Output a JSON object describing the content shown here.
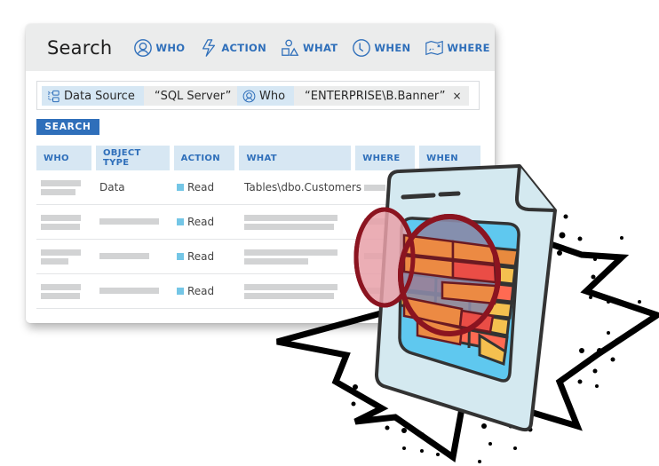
{
  "header": {
    "title": "Search",
    "nav": [
      {
        "label": "WHO",
        "icon": "user-circle-icon"
      },
      {
        "label": "ACTION",
        "icon": "lightning-icon"
      },
      {
        "label": "WHAT",
        "icon": "shapes-icon"
      },
      {
        "label": "WHEN",
        "icon": "clock-icon"
      },
      {
        "label": "WHERE",
        "icon": "map-icon"
      }
    ]
  },
  "filters": [
    {
      "key": "Data Source",
      "value": "“SQL Server”",
      "remove": "×",
      "icon": "hierarchy-icon"
    },
    {
      "key": "Who",
      "value": "“ENTERPRISE\\B.Banner”",
      "remove": "×",
      "icon": "user-circle-icon"
    }
  ],
  "search_button": "SEARCH",
  "table": {
    "columns": [
      "WHO",
      "OBJECT TYPE",
      "ACTION",
      "WHAT",
      "WHERE",
      "WHEN"
    ],
    "rows": [
      {
        "who": "",
        "object_type": "Data",
        "action": "Read",
        "what": "Tables\\dbo.Customers",
        "where": "",
        "when": ""
      },
      {
        "who": "",
        "object_type": "",
        "action": "Read",
        "what": "",
        "where": "",
        "when": ""
      },
      {
        "who": "",
        "object_type": "",
        "action": "Read",
        "what": "",
        "where": "",
        "when": ""
      },
      {
        "who": "",
        "object_type": "",
        "action": "Read",
        "what": "",
        "where": "",
        "when": ""
      }
    ]
  },
  "colors": {
    "accent": "#2f6fba",
    "header_bg": "#ebecec",
    "column_bg": "#d7e7f3",
    "read_marker": "#74c6e6",
    "magnifier": "#8b1420"
  },
  "illustration": {
    "subject": "document-with-table-under-magnifier-on-starburst"
  }
}
